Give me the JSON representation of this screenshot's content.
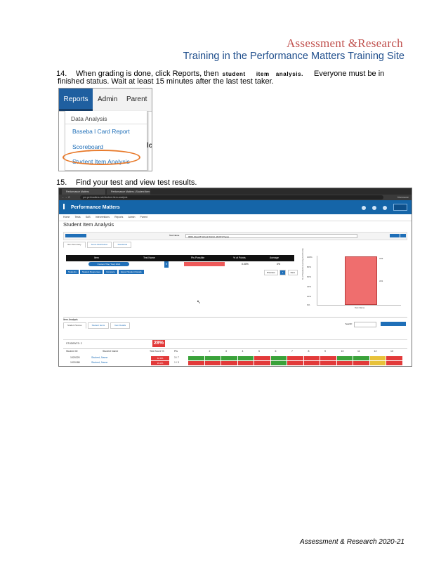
{
  "header": {
    "title": "Assessment  &Research",
    "subtitle": "Training in the Performance Matters Training Site"
  },
  "step14": {
    "number": "14.",
    "text_a": "When grading is done, click Reports, then",
    "text_student": "student",
    "text_item": "item",
    "text_analysis": "analysis.",
    "text_b": "Everyone must be in",
    "line2": "finished status. Wait at least 15 minutes  after the last test taker."
  },
  "screenshot1": {
    "tabs": [
      "Reports",
      "Admin",
      "Parent"
    ],
    "menu_items": [
      "Data Analysis",
      "Baseba l Card Report",
      "Scoreboard",
      "Student Item Analysis"
    ],
    "side_text": "lc"
  },
  "step15": {
    "number": "15.",
    "text": "Find your test and view test results."
  },
  "screenshot2": {
    "browser_tabs": [
      "Performance Matters",
      "Performance Matters | Student Item"
    ],
    "url": "pm.perfmatters.net/student-item-analysis",
    "brand": "Performance Matters",
    "user": "Username",
    "menu": [
      "Home",
      "Tests",
      "SAS",
      "Interventions",
      "Reports",
      "Admin",
      "Parent"
    ],
    "page_title": "Student Item Analysis",
    "test_label": "Test Name",
    "test_value": "0000_Read 8 School District_WHS 9 Types",
    "tabs_top": [
      "Item Summary",
      "Score Distribution",
      "Standards"
    ],
    "table_headers": [
      "Item",
      "Test Name",
      "Pts Possible",
      "% of Points",
      "Average"
    ],
    "row": {
      "badge": "Content Title (Test) 2021",
      "n": "9",
      "pct": "0.00%",
      "avg": "0%"
    },
    "buttons": [
      "Students",
      "Student Responses",
      "Compare",
      "Export Student Details"
    ],
    "pager": [
      "Previous",
      "1",
      "Next"
    ],
    "chart": {
      "ylabel": "% of Students Earning Full Points",
      "ticks": [
        "100%",
        "80%",
        "60%",
        "40%",
        "20%",
        "0%"
      ],
      "bar_label_top": "A53",
      "bar_label_mid": "A51",
      "xlabel": "Test Name"
    },
    "tabs_bottom_title": "Item Analysis",
    "tabs_bottom": [
      "Student Scores",
      "Student Items",
      "Item Details"
    ],
    "search_label": "Search:",
    "grid": {
      "label_all": "STUDENTS: 2",
      "pct": "28%",
      "col_student_id": "Student ID",
      "col_name": "Student Name",
      "col_score": "Test Score %",
      "col_pts": "Pts",
      "items": [
        "1",
        "2",
        "3",
        "4",
        "5",
        "6",
        "7",
        "8",
        "9",
        "10",
        "11",
        "12",
        "13"
      ],
      "rows": [
        {
          "id": "1020220",
          "name": "Student, Name",
          "score": "42.9%",
          "pts": "3 / 7"
        },
        {
          "id": "1020188",
          "name": "Student, Name",
          "score": "33.3%",
          "pts": "1 / 3"
        }
      ]
    }
  },
  "footer": "Assessment & Research 2020-21"
}
